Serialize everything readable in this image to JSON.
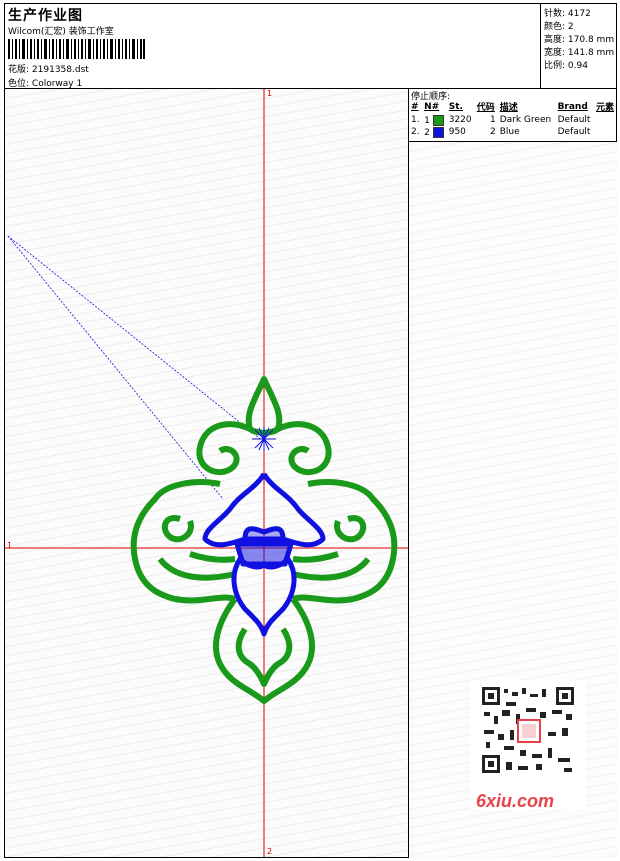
{
  "header": {
    "title": "生产作业图",
    "subtitle": "Wilcom(汇宏) 装饰工作室",
    "design_label": "花版:",
    "design_file": "2191358.dst",
    "colorway_label": "色位:",
    "colorway": "Colorway 1"
  },
  "specs": [
    {
      "label": "针数:",
      "value": "4172"
    },
    {
      "label": "颜色:",
      "value": "2"
    },
    {
      "label": "高度:",
      "value": "170.8 mm"
    },
    {
      "label": "宽度:",
      "value": "141.8 mm"
    },
    {
      "label": "比例:",
      "value": "0.94"
    }
  ],
  "stop_sequence": {
    "title": "停止顺序:",
    "columns": [
      "#",
      "N#",
      "St.",
      "代码",
      "描述",
      "Brand",
      "元素"
    ],
    "rows": [
      {
        "num": "1.",
        "n": "1",
        "color": "#1a9a1a",
        "stitches": "3220",
        "code": "1",
        "desc": "Dark Green",
        "brand": "Default",
        "element": ""
      },
      {
        "num": "2.",
        "n": "2",
        "color": "#1010e0",
        "stitches": "950",
        "code": "2",
        "desc": "Blue",
        "brand": "Default",
        "element": ""
      }
    ]
  },
  "axes": {
    "top": "1",
    "left": "1",
    "bottom": "2"
  },
  "colors": {
    "green": "#1a9a1a",
    "blue": "#1010e0",
    "axis": "#e00000"
  },
  "watermark": {
    "text": "6xiu.com",
    "icon": "qr-code-icon"
  }
}
